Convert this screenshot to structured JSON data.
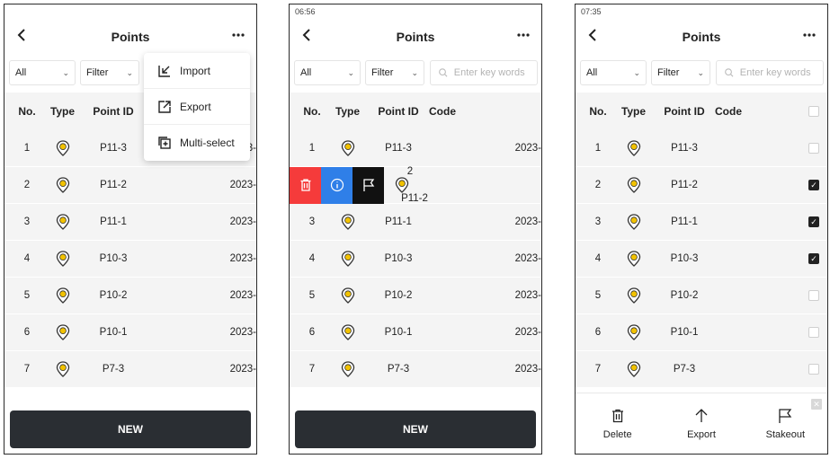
{
  "screens": [
    {
      "status_time": "",
      "title": "Points",
      "filter_all": "All",
      "filter_label": "Filter",
      "search_placeholder": "Enter key words",
      "columns": {
        "no": "No.",
        "type": "Type",
        "point_id": "Point ID",
        "code": "Code"
      },
      "menu": {
        "import": "Import",
        "export": "Export",
        "multi_select": "Multi-select"
      },
      "rows": [
        {
          "no": "1",
          "id": "P11-3",
          "date": "2023-"
        },
        {
          "no": "2",
          "id": "P11-2",
          "date": "2023-"
        },
        {
          "no": "3",
          "id": "P11-1",
          "date": "2023-"
        },
        {
          "no": "4",
          "id": "P10-3",
          "date": "2023-"
        },
        {
          "no": "5",
          "id": "P10-2",
          "date": "2023-"
        },
        {
          "no": "6",
          "id": "P10-1",
          "date": "2023-"
        },
        {
          "no": "7",
          "id": "P7-3",
          "date": "2023-"
        }
      ],
      "new_button": "NEW"
    },
    {
      "status_time": "06:56",
      "title": "Points",
      "filter_all": "All",
      "filter_label": "Filter",
      "search_placeholder": "Enter key words",
      "columns": {
        "no": "No.",
        "type": "Type",
        "point_id": "Point ID",
        "code": "Code"
      },
      "swiped_row": {
        "no": "2",
        "id": "P11-2"
      },
      "rows": [
        {
          "no": "1",
          "id": "P11-3",
          "date": "2023-"
        },
        {
          "no": "3",
          "id": "P11-1",
          "date": "2023-"
        },
        {
          "no": "4",
          "id": "P10-3",
          "date": "2023-"
        },
        {
          "no": "5",
          "id": "P10-2",
          "date": "2023-"
        },
        {
          "no": "6",
          "id": "P10-1",
          "date": "2023-"
        },
        {
          "no": "7",
          "id": "P7-3",
          "date": "2023-"
        }
      ],
      "new_button": "NEW"
    },
    {
      "status_time": "07:35",
      "title": "Points",
      "filter_all": "All",
      "filter_label": "Filter",
      "search_placeholder": "Enter key words",
      "columns": {
        "no": "No.",
        "type": "Type",
        "point_id": "Point ID",
        "code": "Code"
      },
      "rows": [
        {
          "no": "1",
          "id": "P11-3",
          "checked": false
        },
        {
          "no": "2",
          "id": "P11-2",
          "checked": true
        },
        {
          "no": "3",
          "id": "P11-1",
          "checked": true
        },
        {
          "no": "4",
          "id": "P10-3",
          "checked": true
        },
        {
          "no": "5",
          "id": "P10-2",
          "checked": false
        },
        {
          "no": "6",
          "id": "P10-1",
          "checked": false
        },
        {
          "no": "7",
          "id": "P7-3",
          "checked": false
        }
      ],
      "actions": {
        "delete": "Delete",
        "export": "Export",
        "stakeout": "Stakeout"
      }
    }
  ],
  "icons": {
    "back": "chevron-left-icon",
    "more": "more-dots-icon",
    "point_type": "location-pin-icon",
    "search": "search-icon"
  },
  "colors": {
    "delete_red": "#f53b3b",
    "info_blue": "#2f7fe8",
    "stakeout_black": "#111111",
    "pin_yellow": "#f2c200",
    "new_button_bg": "#2a2e33"
  }
}
